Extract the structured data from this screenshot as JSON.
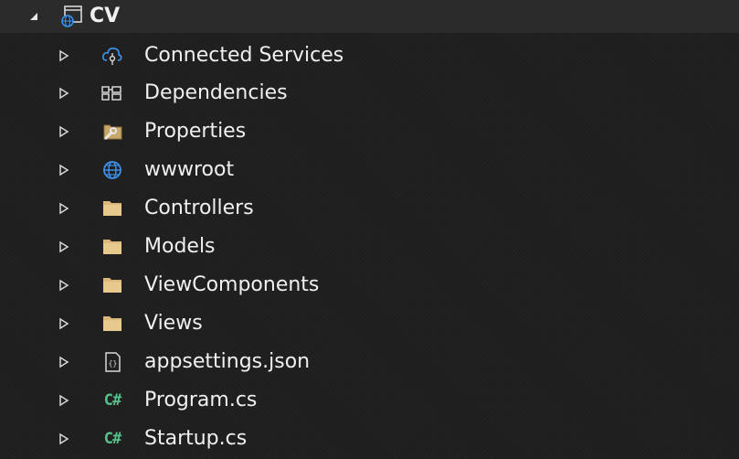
{
  "project": {
    "name": "CV",
    "icon": "web-project-icon",
    "expanded": true
  },
  "items": [
    {
      "label": "Connected Services",
      "icon": "connected-services-icon"
    },
    {
      "label": "Dependencies",
      "icon": "dependencies-icon"
    },
    {
      "label": "Properties",
      "icon": "properties-icon"
    },
    {
      "label": "wwwroot",
      "icon": "globe-icon"
    },
    {
      "label": "Controllers",
      "icon": "folder-icon"
    },
    {
      "label": "Models",
      "icon": "folder-icon"
    },
    {
      "label": "ViewComponents",
      "icon": "folder-icon"
    },
    {
      "label": "Views",
      "icon": "folder-icon"
    },
    {
      "label": "appsettings.json",
      "icon": "json-file-icon"
    },
    {
      "label": "Program.cs",
      "icon": "csharp-file-icon",
      "icon_text": "C#"
    },
    {
      "label": "Startup.cs",
      "icon": "csharp-file-icon",
      "icon_text": "C#"
    }
  ],
  "colors": {
    "background": "#1f1f1f",
    "text": "#f0f0f0",
    "folder": "#dcb67a",
    "csharp": "#57c08a",
    "globe": "#3c8ee6"
  }
}
